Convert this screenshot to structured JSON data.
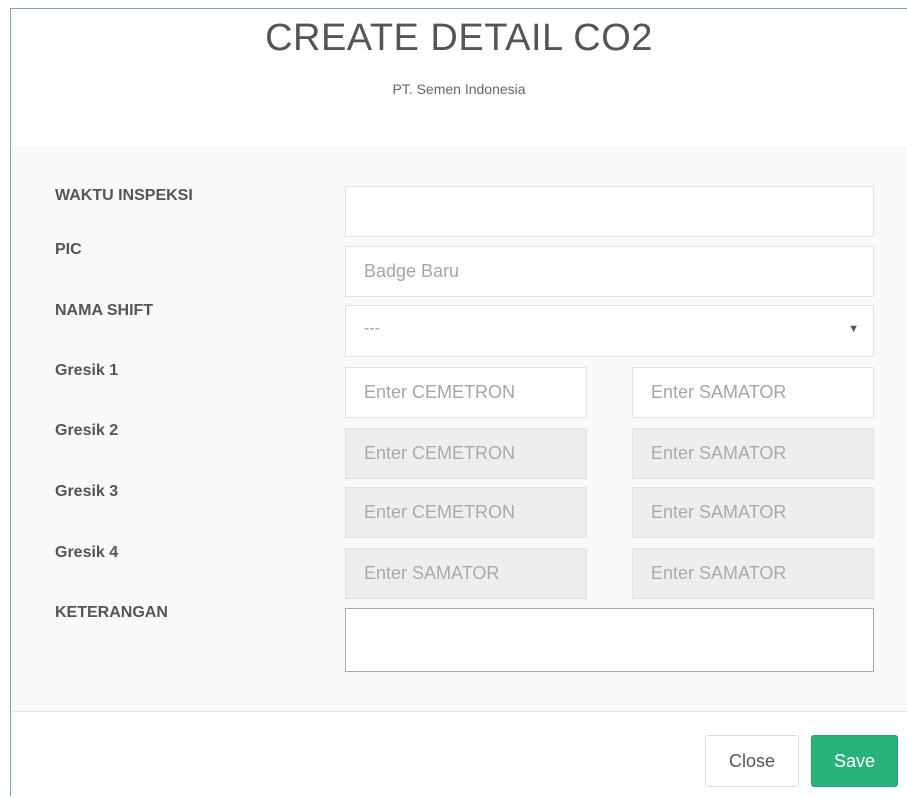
{
  "header": {
    "title": "CREATE DETAIL CO2",
    "subtitle": "PT. Semen Indonesia"
  },
  "form": {
    "waktu_inspeksi": {
      "label": "WAKTU INSPEKSI",
      "value": "",
      "placeholder": ""
    },
    "pic": {
      "label": "PIC",
      "placeholder": "Badge Baru"
    },
    "nama_shift": {
      "label": "NAMA SHIFT",
      "selected": "---"
    },
    "gresik_rows": [
      {
        "label": "Gresik 1",
        "left_placeholder": "Enter CEMETRON",
        "right_placeholder": "Enter SAMATOR",
        "disabled": false
      },
      {
        "label": "Gresik 2",
        "left_placeholder": "Enter CEMETRON",
        "right_placeholder": "Enter SAMATOR",
        "disabled": true
      },
      {
        "label": "Gresik 3",
        "left_placeholder": "Enter CEMETRON",
        "right_placeholder": "Enter SAMATOR",
        "disabled": true
      },
      {
        "label": "Gresik 4",
        "left_placeholder": "Enter SAMATOR",
        "right_placeholder": "Enter SAMATOR",
        "disabled": true
      }
    ],
    "keterangan": {
      "label": "KETERANGAN",
      "value": ""
    }
  },
  "footer": {
    "close_label": "Close",
    "save_label": "Save"
  },
  "colors": {
    "save_button": "#2ab27b",
    "disabled_input": "#eeeeee",
    "body_background": "#f9f9f9"
  },
  "icons": {
    "select_caret": "chevron-down-icon"
  }
}
